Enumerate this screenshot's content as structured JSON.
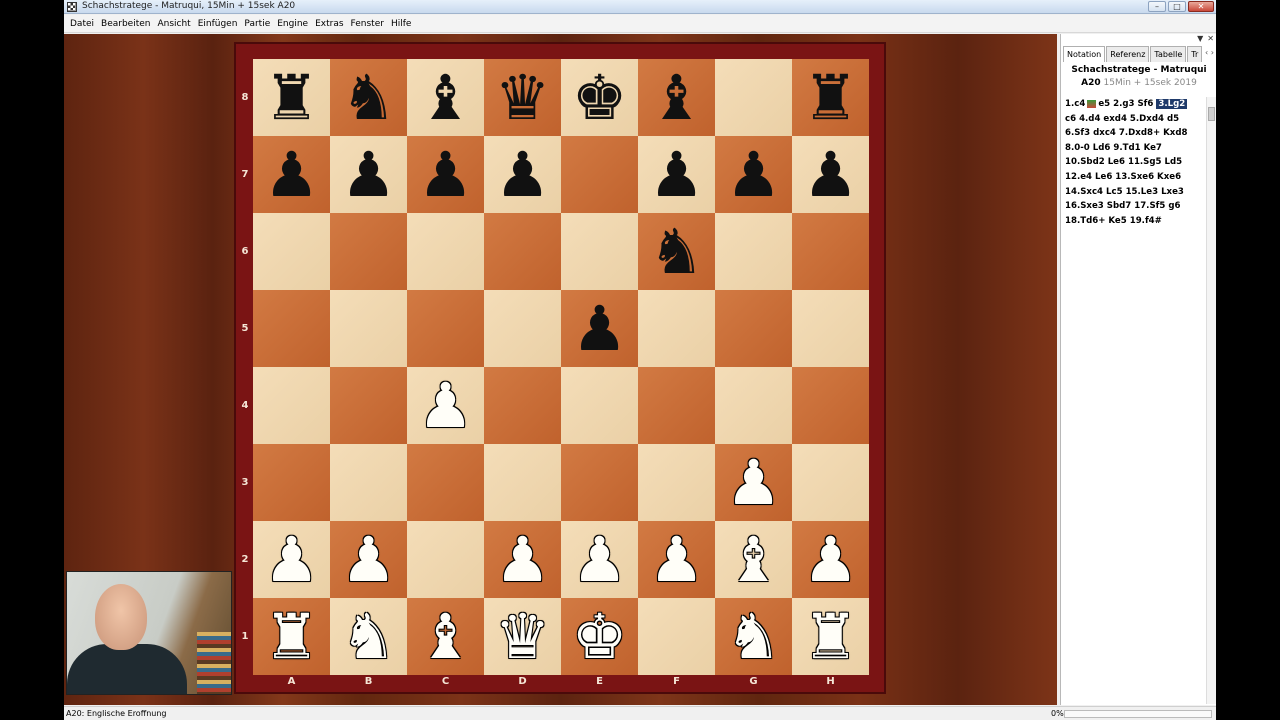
{
  "window": {
    "title": "Schachstratege - Matruqui, 15Min + 15sek  A20"
  },
  "window_buttons": {
    "minimize": "–",
    "maximize": "□",
    "close": "✕"
  },
  "menu": [
    "Datei",
    "Bearbeiten",
    "Ansicht",
    "Einfügen",
    "Partie",
    "Engine",
    "Extras",
    "Fenster",
    "Hilfe"
  ],
  "board": {
    "ranks": [
      "8",
      "7",
      "6",
      "5",
      "4",
      "3",
      "2",
      "1"
    ],
    "files": [
      "A",
      "B",
      "C",
      "D",
      "E",
      "F",
      "G",
      "H"
    ],
    "position": [
      [
        "r",
        "n",
        "b",
        "q",
        "k",
        "b",
        "",
        "r"
      ],
      [
        "p",
        "p",
        "p",
        "p",
        "",
        "p",
        "p",
        "p"
      ],
      [
        "",
        "",
        "",
        "",
        "",
        "n",
        "",
        ""
      ],
      [
        "",
        "",
        "",
        "",
        "p",
        "",
        "",
        ""
      ],
      [
        "",
        "",
        "P",
        "",
        "",
        "",
        "",
        ""
      ],
      [
        "",
        "",
        "",
        "",
        "",
        "",
        "P",
        ""
      ],
      [
        "P",
        "P",
        "",
        "P",
        "P",
        "P",
        "B",
        "P"
      ],
      [
        "R",
        "N",
        "B",
        "Q",
        "K",
        "",
        "N",
        "R"
      ]
    ],
    "colors": {
      "light": "#f0d7b0",
      "dark": "#c96a35",
      "frame": "#7a1414"
    }
  },
  "side_panel": {
    "controls": [
      "▼",
      "✕"
    ],
    "tabs": [
      "Notation",
      "Referenz",
      "Tabelle",
      "Tr"
    ],
    "tab_arrows": "‹ ›",
    "game_title": "Schachstratege - Matruqui",
    "eco": "A20",
    "game_info": "15Min + 15sek 2019",
    "notation": {
      "line1_before": "1.c4",
      "line1_middle": "e5  2.g3  Sf6",
      "current_move": "3.Lg2",
      "lines": [
        "c6  4.d4  exd4  5.Dxd4  d5",
        "6.Sf3  dxc4  7.Dxd8+  Kxd8",
        "8.0-0  Ld6  9.Td1  Ke7",
        "10.Sbd2  Le6  11.Sg5  Ld5",
        "12.e4  Le6  13.Sxe6  Kxe6",
        "14.Sxc4  Lc5  15.Le3  Lxe3",
        "16.Sxe3  Sbd7  17.Sf5  g6",
        "18.Td6+  Ke5  19.f4#"
      ]
    }
  },
  "status": {
    "text": "A20: Englische Eroffnung",
    "progress": "0%"
  }
}
